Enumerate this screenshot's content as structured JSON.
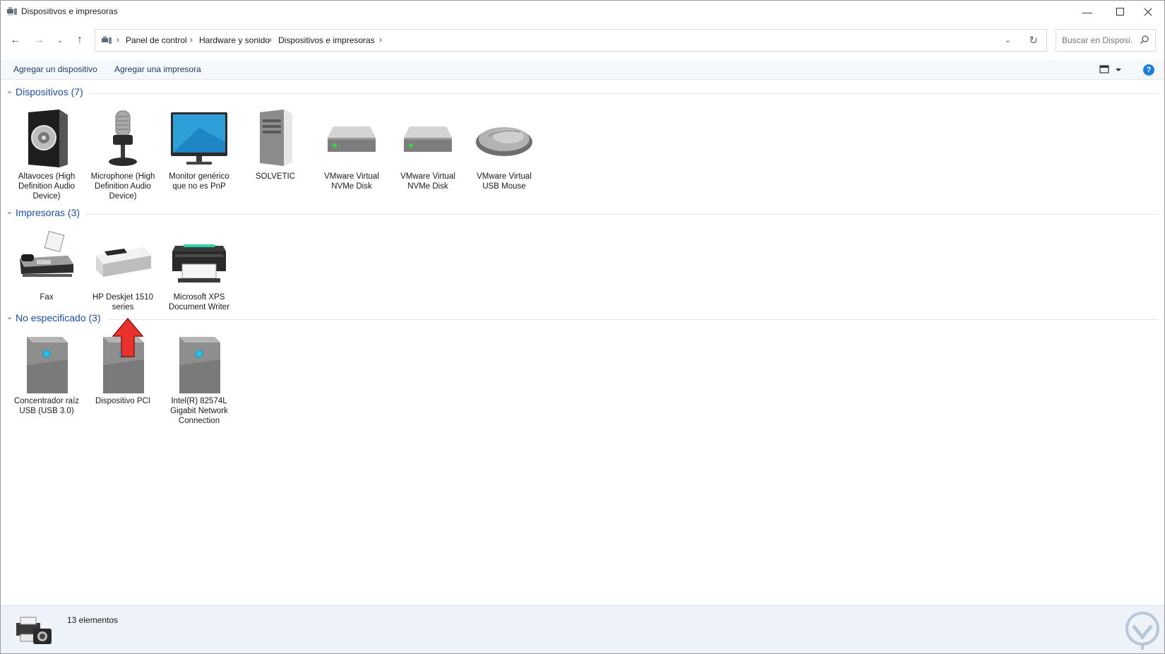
{
  "window": {
    "title": "Dispositivos e impresoras",
    "controls": [
      "minimize",
      "maximize",
      "close"
    ]
  },
  "nav": {
    "breadcrumb": [
      "Panel de control",
      "Hardware y sonido",
      "Dispositivos e impresoras"
    ],
    "search_placeholder": "Buscar en Disposi..."
  },
  "commands": {
    "add_device": "Agregar un dispositivo",
    "add_printer": "Agregar una impresora",
    "help": "?"
  },
  "groups": [
    {
      "title": "Dispositivos (7)",
      "items": [
        {
          "label": "Altavoces (High Definition Audio Device)",
          "icon": "speaker-icon"
        },
        {
          "label": "Microphone (High Definition Audio Device)",
          "icon": "microphone-icon"
        },
        {
          "label": "Monitor genérico que no es PnP",
          "icon": "monitor-icon"
        },
        {
          "label": "SOLVETIC",
          "icon": "computer-tower-icon"
        },
        {
          "label": "VMware Virtual NVMe Disk",
          "icon": "disk-drive-icon"
        },
        {
          "label": "VMware Virtual NVMe Disk",
          "icon": "disk-drive-icon"
        },
        {
          "label": "VMware Virtual USB Mouse",
          "icon": "mouse-icon"
        }
      ]
    },
    {
      "title": "Impresoras (3)",
      "items": [
        {
          "label": "Fax",
          "icon": "fax-icon"
        },
        {
          "label": "HP Deskjet 1510 series",
          "icon": "inkjet-printer-icon"
        },
        {
          "label": "Microsoft XPS Document Writer",
          "icon": "printer-icon"
        }
      ]
    },
    {
      "title": "No especificado (3)",
      "items": [
        {
          "label": "Concentrador raíz USB (USB 3.0)",
          "icon": "generic-device-icon"
        },
        {
          "label": "Dispositivo PCI",
          "icon": "generic-device-icon"
        },
        {
          "label": "Intel(R) 82574L Gigabit Network Connection",
          "icon": "generic-device-icon"
        }
      ]
    }
  ],
  "status": {
    "count_text": "13 elementos"
  },
  "colors": {
    "group_title": "#1f4e99",
    "command_text": "#1e3a5f",
    "status_bg": "#eef3f9",
    "arrow": "#e8322b"
  }
}
